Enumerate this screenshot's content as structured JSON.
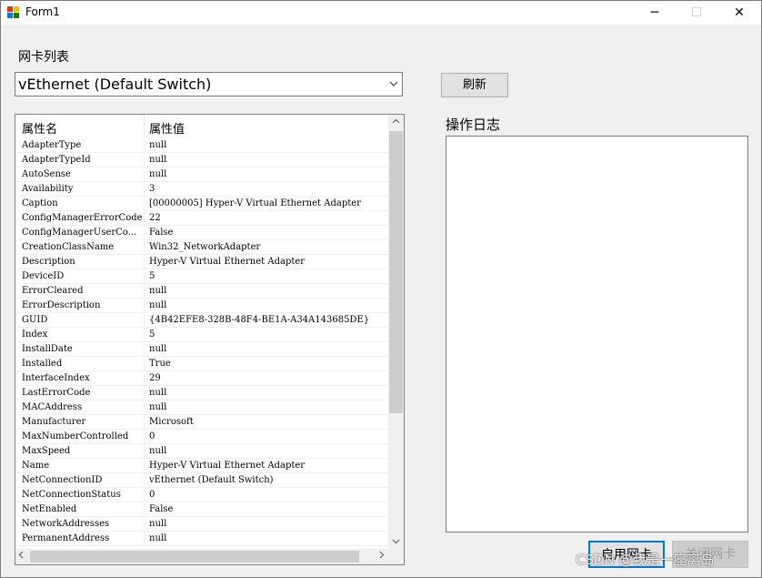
{
  "window": {
    "title": "Form1",
    "minimize_icon": "minimize-icon",
    "maximize_icon": "maximize-icon",
    "close_icon": "close-icon",
    "minimize_glyph": "─",
    "maximize_glyph": "☐",
    "close_glyph": "✕"
  },
  "nic_section": {
    "label": "网卡列表",
    "selected_adapter": "vEthernet (Default Switch)",
    "refresh_label": "刷新"
  },
  "properties_grid": {
    "headers": [
      "属性名",
      "属性值"
    ],
    "rows": [
      {
        "name": "AdapterType",
        "value": "null"
      },
      {
        "name": "AdapterTypeId",
        "value": "null"
      },
      {
        "name": "AutoSense",
        "value": "null"
      },
      {
        "name": "Availability",
        "value": "3"
      },
      {
        "name": "Caption",
        "value": "[00000005] Hyper-V Virtual Ethernet Adapter"
      },
      {
        "name": "ConfigManagerErrorCode",
        "value": "22"
      },
      {
        "name": "ConfigManagerUserCo...",
        "value": "False"
      },
      {
        "name": "CreationClassName",
        "value": "Win32_NetworkAdapter"
      },
      {
        "name": "Description",
        "value": "Hyper-V Virtual Ethernet Adapter"
      },
      {
        "name": "DeviceID",
        "value": "5"
      },
      {
        "name": "ErrorCleared",
        "value": "null"
      },
      {
        "name": "ErrorDescription",
        "value": "null"
      },
      {
        "name": "GUID",
        "value": "{4B42EFE8-328B-48F4-BE1A-A34A143685DE}"
      },
      {
        "name": "Index",
        "value": "5"
      },
      {
        "name": "InstallDate",
        "value": "null"
      },
      {
        "name": "Installed",
        "value": "True"
      },
      {
        "name": "InterfaceIndex",
        "value": "29"
      },
      {
        "name": "LastErrorCode",
        "value": "null"
      },
      {
        "name": "MACAddress",
        "value": "null"
      },
      {
        "name": "Manufacturer",
        "value": "Microsoft"
      },
      {
        "name": "MaxNumberControlled",
        "value": "0"
      },
      {
        "name": "MaxSpeed",
        "value": "null"
      },
      {
        "name": "Name",
        "value": "Hyper-V Virtual Ethernet Adapter"
      },
      {
        "name": "NetConnectionID",
        "value": "vEthernet (Default Switch)"
      },
      {
        "name": "NetConnectionStatus",
        "value": "0"
      },
      {
        "name": "NetEnabled",
        "value": "False"
      },
      {
        "name": "NetworkAddresses",
        "value": "null"
      },
      {
        "name": "PermanentAddress",
        "value": "null"
      }
    ]
  },
  "log_section": {
    "label": "操作日志",
    "content": ""
  },
  "actions": {
    "enable_label": "启用网卡",
    "disable_label": "关闭网卡"
  },
  "watermark": "CSDN @我是一座离岛"
}
